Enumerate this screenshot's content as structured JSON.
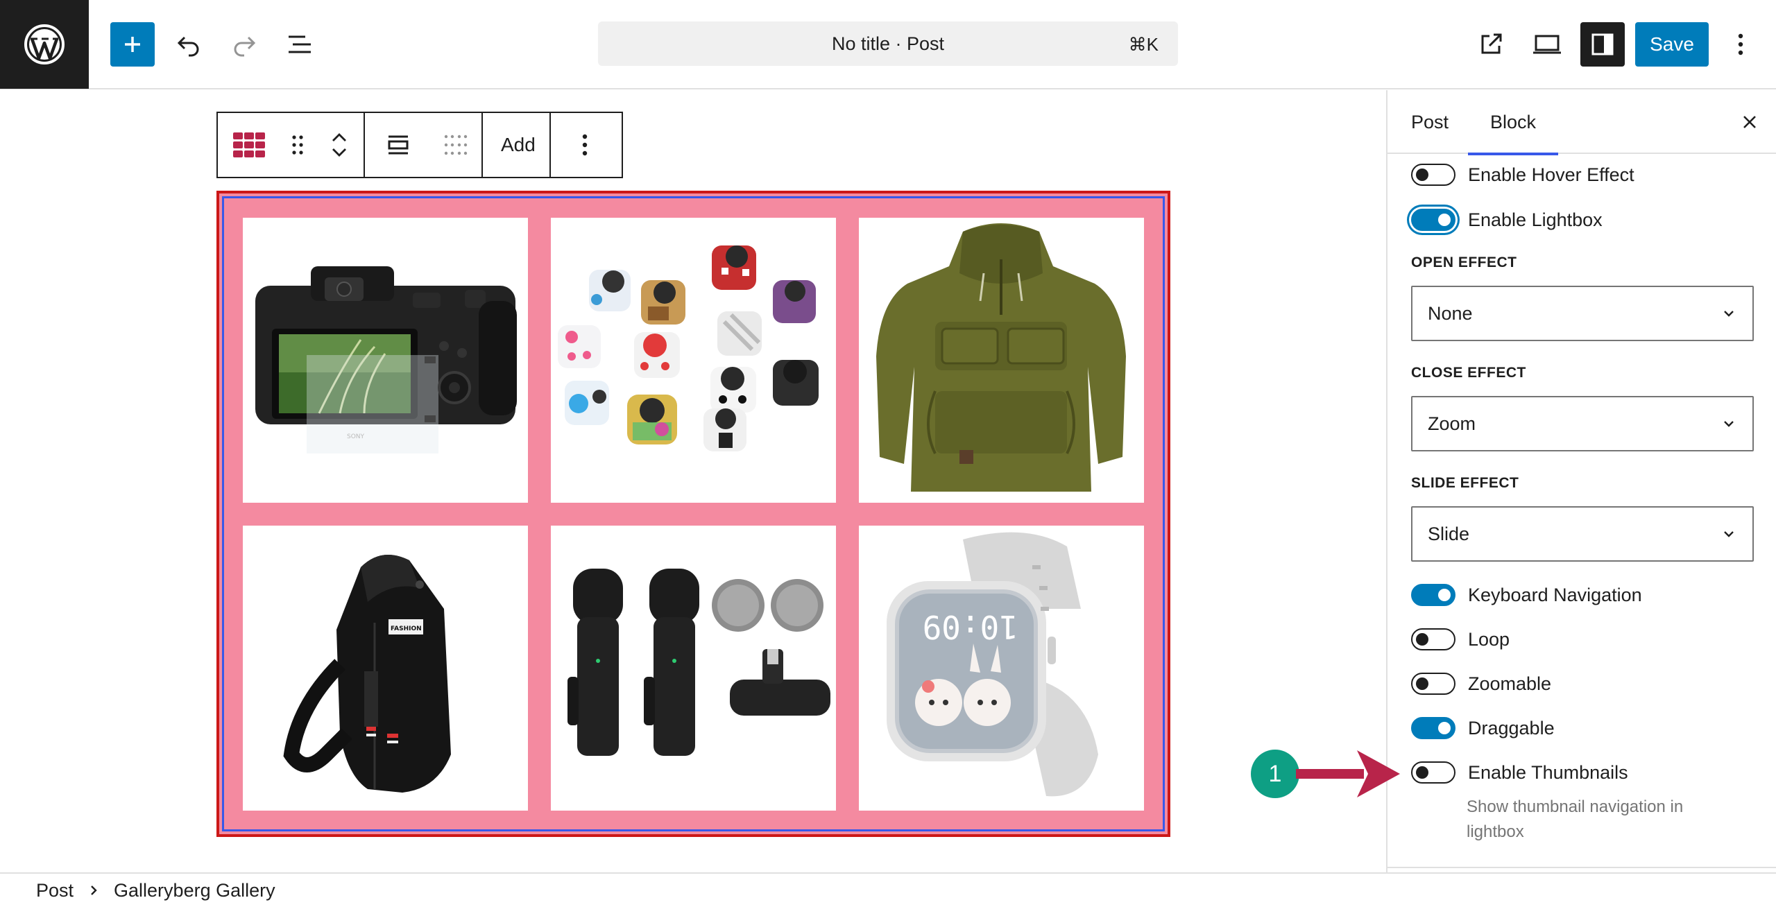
{
  "header": {
    "document_title": "No title · Post",
    "shortcut": "⌘K",
    "save_label": "Save",
    "icons": [
      "wordpress-logo",
      "plus-icon",
      "undo-icon",
      "redo-icon",
      "list-view-icon",
      "external-link-icon",
      "desktop-preview-icon",
      "sidebar-toggle-icon",
      "more-vertical-icon"
    ]
  },
  "block_toolbar": {
    "add_label": "Add",
    "icons": [
      "gallery-block-icon",
      "drag-handle-icon",
      "chevron-up-icon",
      "chevron-down-icon",
      "align-icon",
      "grid-dots-icon",
      "more-vertical-icon"
    ]
  },
  "gallery": {
    "images": [
      "camera",
      "fidget-cubes",
      "green-hoodie",
      "sling-bag",
      "wireless-microphones",
      "smartwatch"
    ]
  },
  "sidebar": {
    "tabs": [
      {
        "label": "Post",
        "active": false
      },
      {
        "label": "Block",
        "active": true
      }
    ],
    "enable_hover_effect": {
      "label": "Enable Hover Effect",
      "on": false
    },
    "enable_lightbox": {
      "label": "Enable Lightbox",
      "on": true
    },
    "open_effect": {
      "label": "OPEN EFFECT",
      "value": "None"
    },
    "close_effect": {
      "label": "CLOSE EFFECT",
      "value": "Zoom"
    },
    "slide_effect": {
      "label": "SLIDE EFFECT",
      "value": "Slide"
    },
    "keyboard_navigation": {
      "label": "Keyboard Navigation",
      "on": true
    },
    "loop": {
      "label": "Loop",
      "on": false
    },
    "zoomable": {
      "label": "Zoomable",
      "on": false
    },
    "draggable": {
      "label": "Draggable",
      "on": true
    },
    "enable_thumbnails": {
      "label": "Enable Thumbnails",
      "on": false,
      "help": "Show thumbnail navigation in lightbox"
    }
  },
  "annotation": {
    "badge": "1",
    "colors": {
      "badge": "#0e9f84",
      "arrow": "#b8244a"
    }
  },
  "breadcrumb": {
    "items": [
      "Post",
      "Galleryberg Gallery"
    ]
  },
  "colors": {
    "accent": "#007cba",
    "gallery_background": "#f48aa0",
    "gallery_border": "#cc1818"
  }
}
